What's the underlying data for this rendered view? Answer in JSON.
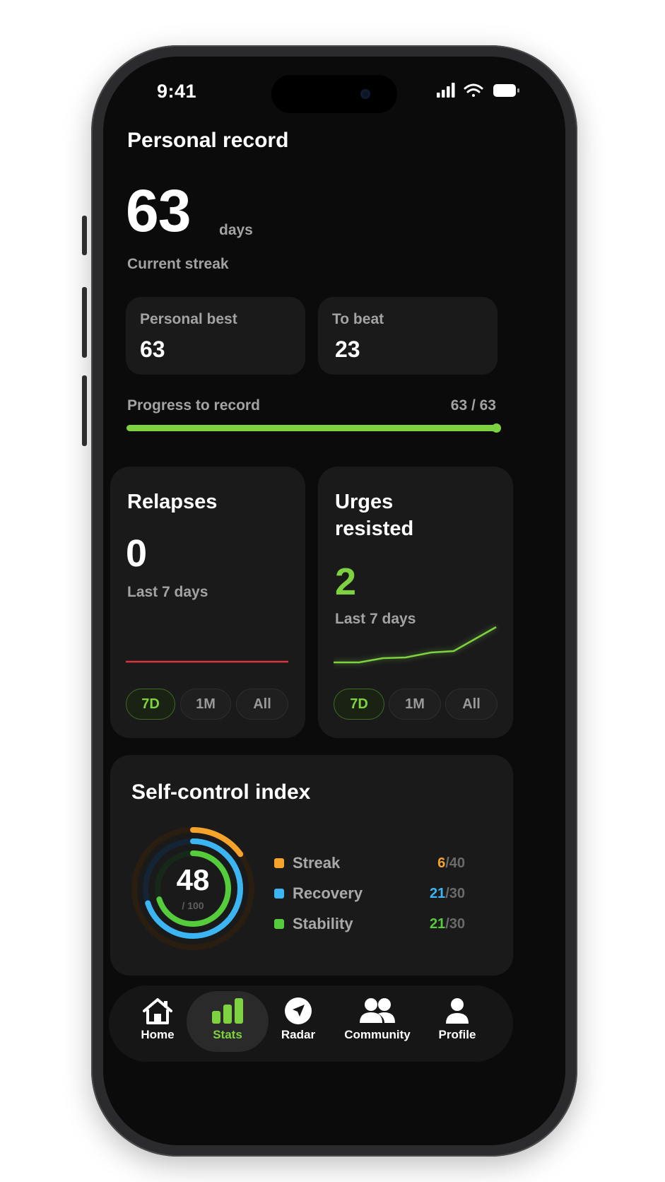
{
  "status_bar": {
    "time": "9:41"
  },
  "record": {
    "title": "Personal record",
    "streak_value": "63",
    "streak_unit": "days",
    "streak_label": "Current streak",
    "personal_best_label": "Personal best",
    "personal_best_value": "63",
    "to_beat_label": "To beat",
    "to_beat_value": "23",
    "progress_label": "Progress to record",
    "progress_text": "63 / 63",
    "progress_fraction": 1.0
  },
  "relapses": {
    "title": "Relapses",
    "value": "0",
    "period_label": "Last 7 days",
    "ranges": [
      "7D",
      "1M",
      "All"
    ],
    "active_range": "7D"
  },
  "urges": {
    "title_line1": "Urges",
    "title_line2": "resisted",
    "value": "2",
    "period_label": "Last 7 days",
    "ranges": [
      "7D",
      "1M",
      "All"
    ],
    "active_range": "7D"
  },
  "self_control": {
    "title": "Self-control index",
    "score": "48",
    "score_max": "/ 100",
    "items": [
      {
        "label": "Streak",
        "value": "6",
        "max": "/40",
        "color": "#f5a32b",
        "fraction": 0.15
      },
      {
        "label": "Recovery",
        "value": "21",
        "max": "/30",
        "color": "#3bb6f2",
        "fraction": 0.7
      },
      {
        "label": "Stability",
        "value": "21",
        "max": "/30",
        "color": "#55cc3c",
        "fraction": 0.7
      }
    ]
  },
  "nav": [
    {
      "label": "Home",
      "icon": "home-icon",
      "active": false
    },
    {
      "label": "Stats",
      "icon": "stats-icon",
      "active": true
    },
    {
      "label": "Radar",
      "icon": "radar-icon",
      "active": false
    },
    {
      "label": "Community",
      "icon": "community-icon",
      "active": false
    },
    {
      "label": "Profile",
      "icon": "profile-icon",
      "active": false
    }
  ],
  "colors": {
    "accent": "#7ed23f",
    "relapse_line": "#d9333f",
    "background": "#0b0b0b",
    "card": "#1a1a1b"
  }
}
